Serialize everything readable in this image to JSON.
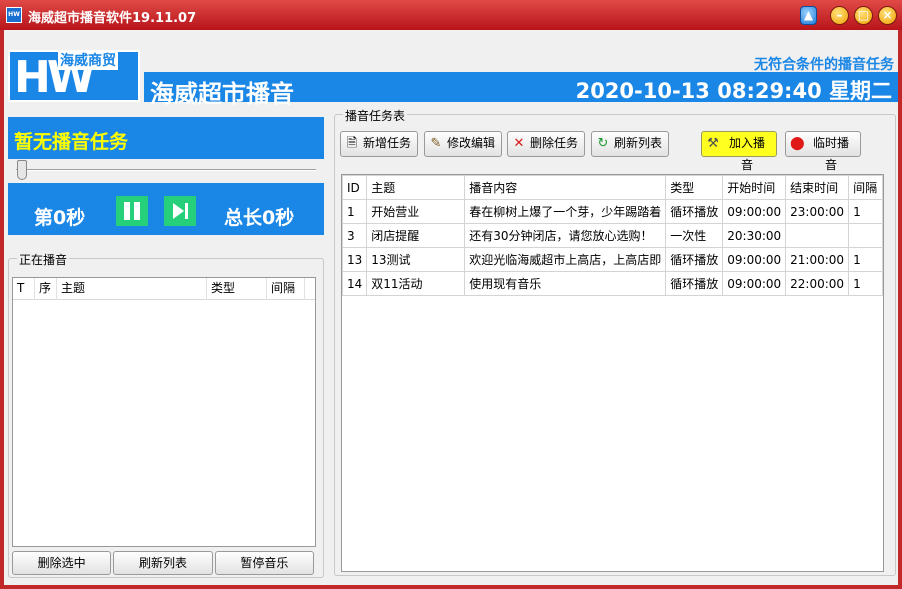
{
  "window": {
    "title": "海威超市播音软件19.11.07",
    "app_icon_text": "HW"
  },
  "header": {
    "logo_letters": "HW",
    "logo_name": "海威商贸",
    "app_name": "海威超市播音",
    "status": "无符合条件的播音任务",
    "clock": "2020-10-13 08:29:40 星期二"
  },
  "player": {
    "current_title": "暂无播音任务",
    "progress": 0,
    "elapsed": "第0秒",
    "total": "总长0秒"
  },
  "playing": {
    "group_label": "正在播音",
    "columns": [
      "T",
      "序",
      "主题",
      "类型",
      "间隔"
    ],
    "rows": [],
    "buttons": [
      "删除选中",
      "刷新列表",
      "暂停音乐"
    ]
  },
  "tasks": {
    "group_label": "播音任务表",
    "toolbar": {
      "add": "新增任务",
      "edit": "修改编辑",
      "delete": "删除任务",
      "refresh": "刷新列表",
      "play": "加入播音",
      "temp": "临时播音"
    },
    "columns": [
      "ID",
      "主题",
      "播音内容",
      "类型",
      "开始时间",
      "结束时间",
      "间隔"
    ],
    "rows": [
      [
        "1",
        "开始营业",
        "春在柳树上爆了一个芽，少年踢踏着",
        "循环播放",
        "09:00:00",
        "23:00:00",
        "1"
      ],
      [
        "3",
        "闭店提醒",
        "还有30分钟闭店，请您放心选购！",
        "一次性",
        "20:30:00",
        "",
        ""
      ],
      [
        "13",
        "13测试",
        "欢迎光临海威超市上高店，上高店即",
        "循环播放",
        "09:00:00",
        "21:00:00",
        "1"
      ],
      [
        "14",
        "双11活动",
        "使用现有音乐",
        "循环播放",
        "09:00:00",
        "22:00:00",
        "1"
      ]
    ]
  }
}
